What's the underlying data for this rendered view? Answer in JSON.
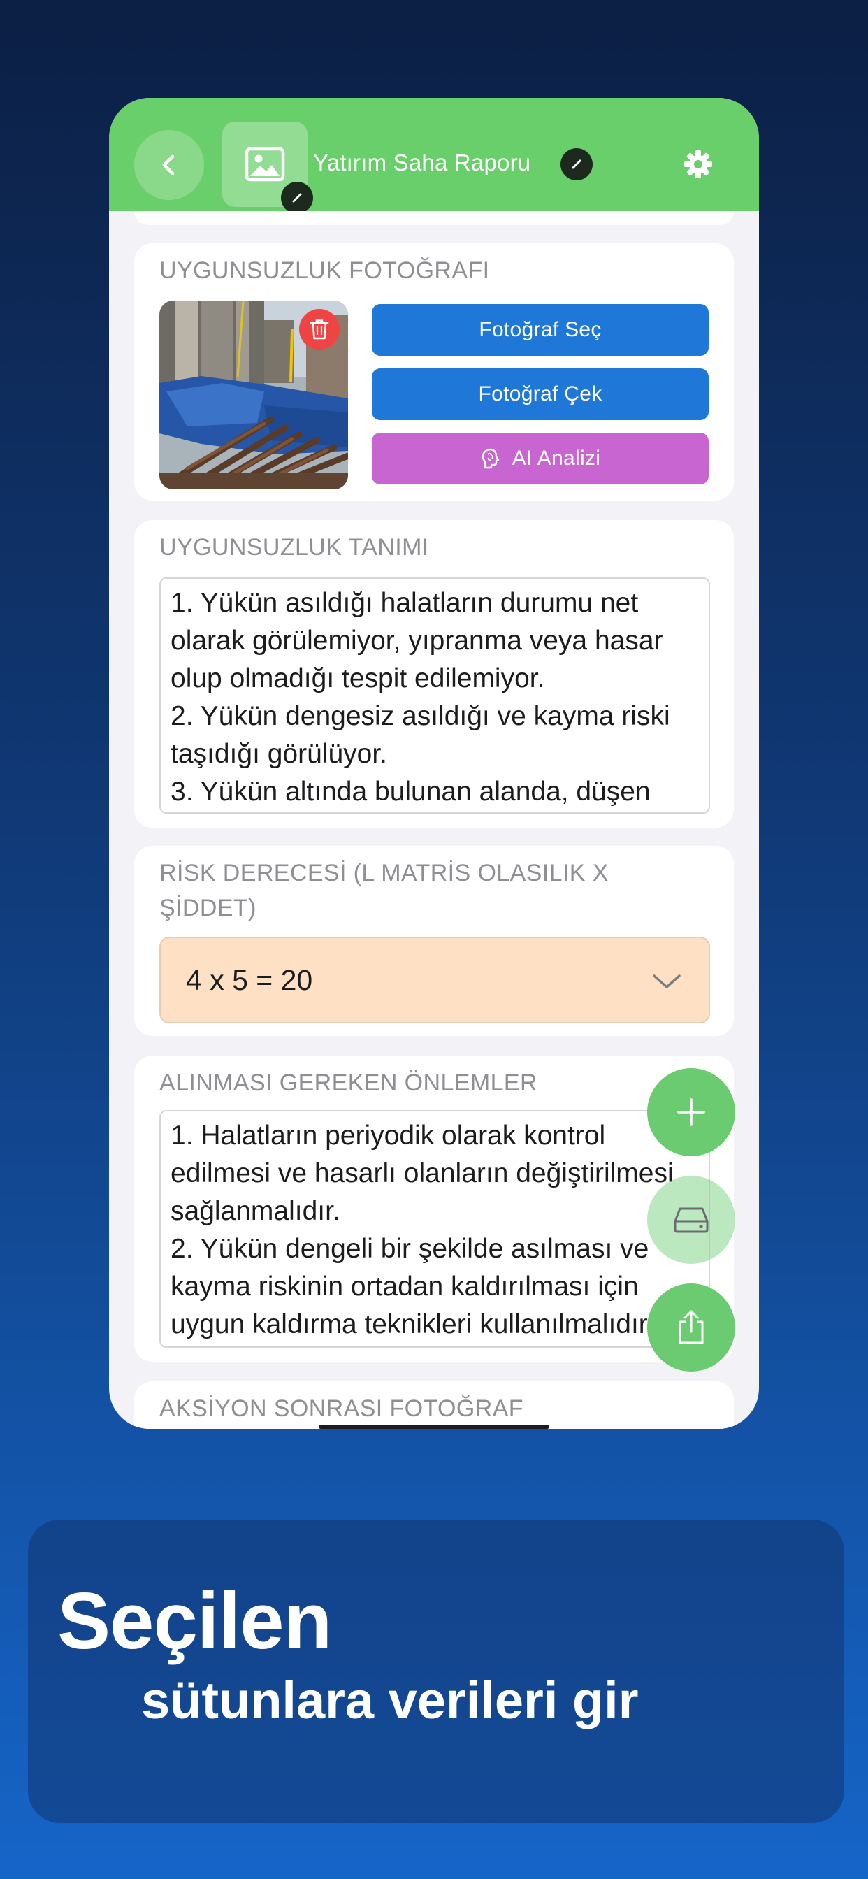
{
  "header": {
    "title": "Yatırım Saha Raporu",
    "back_icon": "chevron-left-icon",
    "image_icon": "image-icon",
    "edit_icon": "pencil-icon",
    "settings_icon": "gear-icon"
  },
  "photo_card": {
    "label": "UYGUNSUZLUK FOTOĞRAFI",
    "choose_photo": "Fotoğraf Seç",
    "take_photo": "Fotoğraf Çek",
    "ai_analysis": "AI Analizi",
    "ai_icon": "brain-icon",
    "delete_icon": "trash-icon"
  },
  "description_card": {
    "label": "UYGUNSUZLUK TANIMI",
    "value": "1. Yükün asıldığı halatların durumu net olarak görülemiyor, yıpranma veya hasar olup olmadığı tespit edilemiyor.\n2. Yükün dengesiz asıldığı ve kayma riski taşıdığı görülüyor.\n3. Yükün altında bulunan alanda, düşen"
  },
  "risk_card": {
    "label": "RİSK DERECESİ (L MATRİS OLASILIK X ŞİDDET)",
    "value": "4 x 5 = 20",
    "chevron_icon": "chevron-down-icon"
  },
  "measures_card": {
    "label": "ALINMASI GEREKEN ÖNLEMLER",
    "value": "1. Halatların periyodik olarak kontrol edilmesi ve hasarlı olanların değiştirilmesi sağlanmalıdır.\n2. Yükün dengeli bir şekilde asılması ve kayma riskinin ortadan kaldırılması için uygun kaldırma teknikleri kullanılmalıdır."
  },
  "after_card": {
    "label": "AKSİYON SONRASI FOTOĞRAF"
  },
  "fabs": {
    "add_icon": "plus-icon",
    "save_icon": "drive-icon",
    "share_icon": "share-icon"
  },
  "promo": {
    "line1": "Seçilen",
    "line2": "sütunlara verileri gir"
  },
  "colors": {
    "header_green": "#69cf6a",
    "button_blue": "#1f78d8",
    "button_purple": "#c965d0",
    "delete_red": "#ef4444",
    "risk_orange": "#fee0c4"
  }
}
